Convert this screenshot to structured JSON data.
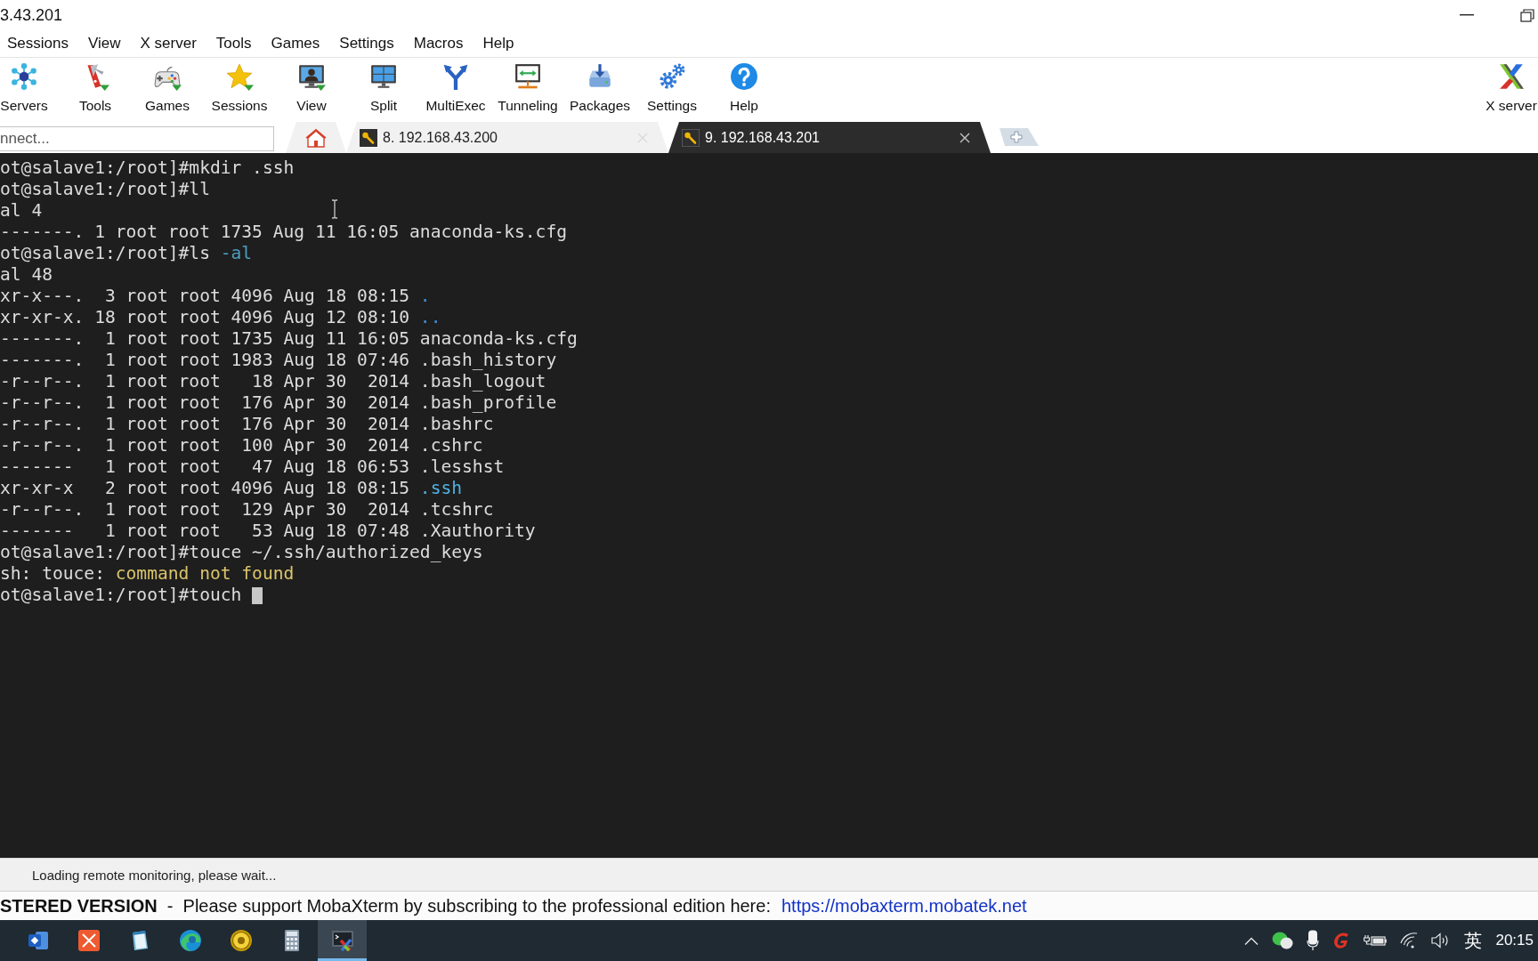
{
  "window": {
    "title": "3.43.201"
  },
  "menu": [
    "Sessions",
    "View",
    "X server",
    "Tools",
    "Games",
    "Settings",
    "Macros",
    "Help"
  ],
  "toolbar": {
    "buttons": [
      {
        "label": "Servers",
        "dropdown": false
      },
      {
        "label": "Tools",
        "dropdown": true
      },
      {
        "label": "Games",
        "dropdown": true
      },
      {
        "label": "Sessions",
        "dropdown": true
      },
      {
        "label": "View",
        "dropdown": true
      },
      {
        "label": "Split",
        "dropdown": false
      },
      {
        "label": "MultiExec",
        "dropdown": false
      },
      {
        "label": "Tunneling",
        "dropdown": false
      },
      {
        "label": "Packages",
        "dropdown": false
      },
      {
        "label": "Settings",
        "dropdown": false
      },
      {
        "label": "Help",
        "dropdown": false
      }
    ],
    "x_server": {
      "label": "X server"
    }
  },
  "tab_bar": {
    "quick_connect": {
      "placeholder": "nnect..."
    },
    "tabs": [
      {
        "kind": "home",
        "selected": false
      },
      {
        "kind": "session",
        "label": "8. 192.168.43.200",
        "selected": false
      },
      {
        "kind": "session",
        "label": "9. 192.168.43.201",
        "selected": true
      }
    ]
  },
  "terminal": {
    "lines": [
      {
        "text": "ot@salave1:/root]#mkdir .ssh"
      },
      {
        "text": "ot@salave1:/root]#ll"
      },
      {
        "text": "al 4"
      },
      {
        "text": "-------. 1 root root 1735 Aug 11 16:05 anaconda-ks.cfg"
      },
      {
        "segments": [
          {
            "text": "ot@salave1:/root]#ls "
          },
          {
            "text": "-al",
            "color": "#4c9fc0"
          }
        ]
      },
      {
        "text": "al 48"
      },
      {
        "segments": [
          {
            "text": "xr-x---.  3 root root 4096 Aug 18 08:15 "
          },
          {
            "text": ".",
            "color": "#3d8fe0"
          }
        ]
      },
      {
        "segments": [
          {
            "text": "xr-xr-x. 18 root root 4096 Aug 12 08:10 "
          },
          {
            "text": "..",
            "color": "#3d8fe0"
          }
        ]
      },
      {
        "text": "-------.  1 root root 1735 Aug 11 16:05 anaconda-ks.cfg"
      },
      {
        "text": "-------.  1 root root 1983 Aug 18 07:46 .bash_history"
      },
      {
        "text": "-r--r--.  1 root root   18 Apr 30  2014 .bash_logout"
      },
      {
        "text": "-r--r--.  1 root root  176 Apr 30  2014 .bash_profile"
      },
      {
        "text": "-r--r--.  1 root root  176 Apr 30  2014 .bashrc"
      },
      {
        "text": "-r--r--.  1 root root  100 Apr 30  2014 .cshrc"
      },
      {
        "text": "-------   1 root root   47 Aug 18 06:53 .lesshst"
      },
      {
        "segments": [
          {
            "text": "xr-xr-x   2 root root 4096 Aug 18 08:15 "
          },
          {
            "text": ".ssh",
            "color": "#4fb0e0"
          }
        ]
      },
      {
        "text": "-r--r--.  1 root root  129 Apr 30  2014 .tcshrc"
      },
      {
        "text": "-------   1 root root   53 Aug 18 07:48 .Xauthority"
      },
      {
        "text": "ot@salave1:/root]#touce ~/.ssh/authorized_keys"
      },
      {
        "segments": [
          {
            "text": "sh: touce: "
          },
          {
            "text": "command not found",
            "color": "#d9c46a"
          }
        ]
      },
      {
        "text": "ot@salave1:/root]#touch"
      }
    ],
    "cursor": true
  },
  "status_bar": {
    "text": "Loading remote monitoring, please wait..."
  },
  "banner": {
    "text": "**STERED VERSION**  -  Please support MobaXterm by subscribing to the professional edition here:",
    "link": "https://mobaxterm.mobatek.net"
  },
  "taskbar": {
    "apps": [
      {
        "selected": false
      },
      {
        "selected": false
      },
      {
        "selected": false
      },
      {
        "selected": false
      },
      {
        "selected": false
      },
      {
        "selected": false
      },
      {
        "selected": true
      }
    ],
    "tray": {
      "input_method": "英",
      "clock": "20:15"
    }
  }
}
